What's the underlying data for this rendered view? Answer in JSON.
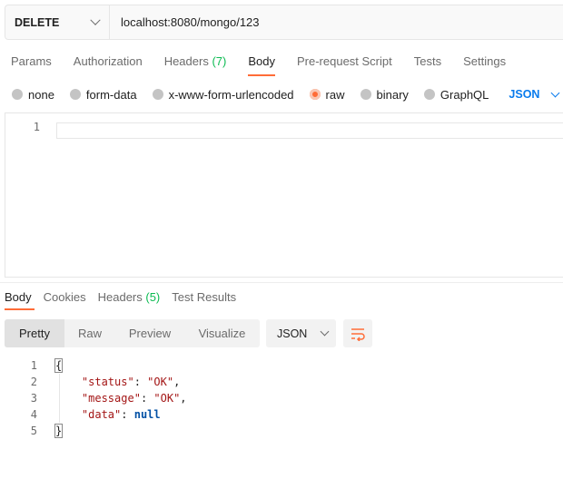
{
  "request": {
    "method": "DELETE",
    "url": "localhost:8080/mongo/123"
  },
  "request_tabs": [
    {
      "label": "Params"
    },
    {
      "label": "Authorization"
    },
    {
      "label": "Headers",
      "count": "(7)"
    },
    {
      "label": "Body"
    },
    {
      "label": "Pre-request Script"
    },
    {
      "label": "Tests"
    },
    {
      "label": "Settings"
    }
  ],
  "active_request_tab": "Body",
  "body_types": [
    "none",
    "form-data",
    "x-www-form-urlencoded",
    "raw",
    "binary",
    "GraphQL"
  ],
  "selected_body_type": "raw",
  "body_format": "JSON",
  "editor": {
    "line_numbers": [
      "1"
    ]
  },
  "response_tabs": [
    {
      "label": "Body"
    },
    {
      "label": "Cookies"
    },
    {
      "label": "Headers",
      "count": "(5)"
    },
    {
      "label": "Test Results"
    }
  ],
  "view_modes": [
    "Pretty",
    "Raw",
    "Preview",
    "Visualize"
  ],
  "active_view_mode": "Pretty",
  "response_format": "JSON",
  "response_body": {
    "lines": [
      "1",
      "2",
      "3",
      "4",
      "5"
    ],
    "open_brace": "{",
    "close_brace": "}",
    "status_key": "\"status\"",
    "status_value": "\"OK\"",
    "message_key": "\"message\"",
    "message_value": "\"OK\"",
    "data_key": "\"data\"",
    "data_value": "null"
  },
  "colors": {
    "accent": "#ff6c37",
    "count": "#0cbb52",
    "link": "#097bed"
  },
  "icons": {
    "method_dropdown": "chevron-down-icon",
    "wrap": "wrap-lines-icon"
  }
}
